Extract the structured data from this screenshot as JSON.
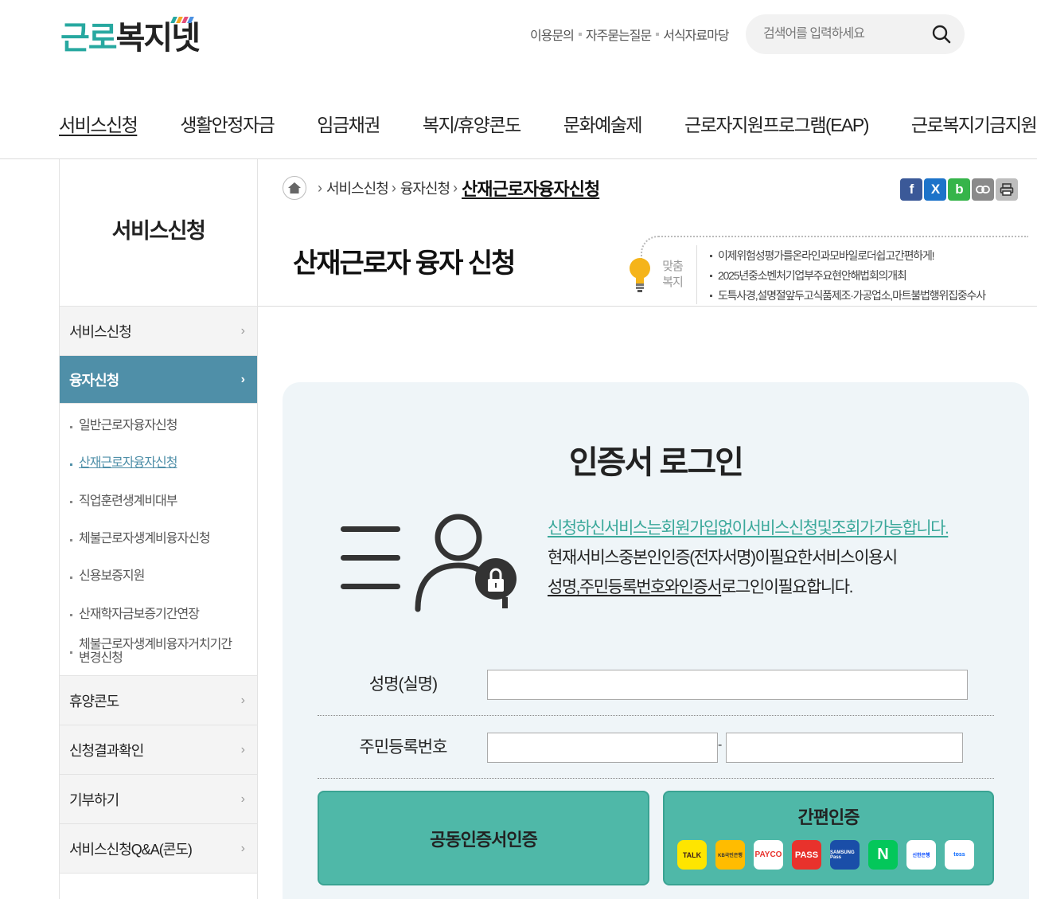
{
  "logo": {
    "part1": "근로",
    "part2": "복지넷"
  },
  "toplinks": [
    "이용문의",
    "자주묻는질문",
    "서식자료마당"
  ],
  "search": {
    "placeholder": "검색어를 입력하세요"
  },
  "gnb": [
    "서비스신청",
    "생활안정자금",
    "임금채권",
    "복지/휴양콘도",
    "문화예술제",
    "근로자지원프로그램(EAP)",
    "근로복지기금지원"
  ],
  "sidebar": {
    "title": "서비스신청",
    "items": [
      {
        "label": "서비스신청"
      },
      {
        "label": "융자신청"
      },
      {
        "label": "휴양콘도"
      },
      {
        "label": "신청결과확인"
      },
      {
        "label": "기부하기"
      },
      {
        "label": "서비스신청Q&A(콘도)"
      }
    ],
    "submenu": [
      "일반근로자융자신청",
      "산재근로자융자신청",
      "직업훈련생계비대부",
      "체불근로자생계비융자신청",
      "신용보증지원",
      "산재학자금보증기간연장",
      "체불근로자생계비융자거치기간변경신청"
    ]
  },
  "breadcrumb": {
    "level1": "서비스신청",
    "level2": "융자신청",
    "current": "산재근로자융자신청"
  },
  "sns": {
    "facebook": "f",
    "x": "X",
    "band": "b"
  },
  "page_title": "산재근로자 융자 신청",
  "tip": {
    "label1": "맞춤",
    "label2": "복지",
    "items": [
      "이제위험성평가를온라인과모바일로더쉽고간편하게!",
      "2025년중소벤처기업부주요현안해법회의개최",
      "도특사경,설명절앞두고식품제조·가공업소,마트불법행위집중수사"
    ]
  },
  "login": {
    "title": "인증서 로그인",
    "info_highlight": "신청하신서비스는회원가입없이서비스신청및조회가가능합니다.",
    "info_line2": "현재서비스중본인인증(전자서명)이필요한서비스이용시",
    "info_line3_a": "성명,",
    "info_line3_b": "주민등록번호와인증서",
    "info_line3_c": "로그인이필요합니다.",
    "name_label": "성명(실명)",
    "name_value": "",
    "rrn_label": "주민등록번호",
    "rrn_first": "",
    "rrn_second": "",
    "rrn_sep": "-",
    "cert_button": "공동인증서인증",
    "simple_button": "간편인증",
    "providers": [
      "TALK",
      "KB국민은행",
      "PAYCO",
      "PASS",
      "SAMSUNG Pass",
      "N",
      "신한은행",
      "toss"
    ]
  },
  "colors": {
    "accent": "#27a8a0",
    "sidebar_active": "#4f8fa8",
    "button": "#4fb8a8",
    "highlight": "#3aa89a"
  }
}
